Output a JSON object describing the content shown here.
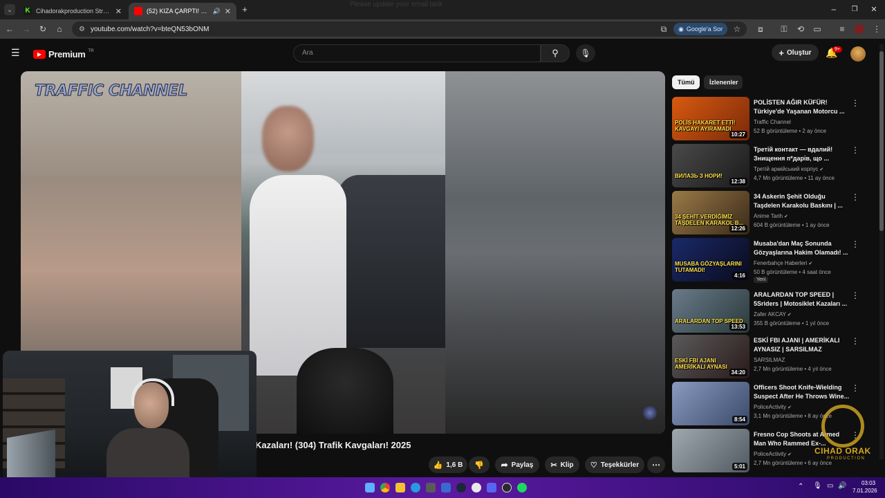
{
  "tabs": [
    {
      "title": "Cihadorakproduction Stream -",
      "favicon": "kick-icon",
      "active": false
    },
    {
      "title": "(52) KIZA ÇARPTI! Türkiye'd",
      "favicon": "youtube-icon",
      "active": true
    }
  ],
  "overlay_text": "Please update your email task",
  "browser": {
    "url": "youtube.com/watch?v=bteQN53bONM",
    "ask_google": "Google'a Sor"
  },
  "youtube": {
    "logo": "Premium",
    "region": "TR",
    "search_placeholder": "Ara",
    "create_label": "Oluştur",
    "notif_badge": "9+"
  },
  "video": {
    "channel_watermark": "TRAFFIC CHANNEL",
    "title_visible": "Kazaları! (304) Trafik Kavgaları! 2025",
    "actions": {
      "likes": "1,6 B",
      "share": "Paylaş",
      "clip": "Klip",
      "thanks": "Teşekkürler"
    }
  },
  "sidebar": {
    "chips": [
      "Tümü",
      "İzlenenler"
    ],
    "recommendations": [
      {
        "title": "POLİSTEN AĞIR KÜFÜR! Türkiye'de Yaşanan Motorcu ...",
        "channel": "Traffic Channel",
        "meta": "52 B görüntüleme • 2 ay önce",
        "duration": "10:27",
        "verified": false,
        "thumb_text": "POLİS HAKARET ETTİ! KAVGAYI AYIRAMADI",
        "thumb_colors": [
          "#d85a10",
          "#7a2a0a"
        ]
      },
      {
        "title": "Третій контакт — вдалий! Знищення п*дарів, що ...",
        "channel": "Третій армійський корпус",
        "meta": "4,7 Mn görüntüleme • 11 ay önce",
        "duration": "12:38",
        "verified": true,
        "thumb_text": "ВИЛАЗЬ З НОРИ!",
        "thumb_colors": [
          "#4a4a4a",
          "#1a1a1a"
        ]
      },
      {
        "title": "34 Askerin Şehit Olduğu Taşdelen Karakolu Baskını | ...",
        "channel": "Anime Tarih",
        "meta": "604 B görüntüleme • 1 ay önce",
        "duration": "12:26",
        "verified": true,
        "thumb_text": "34 ŞEHİT VERDİĞİMİZ TAŞDELEN KARAKOL B...",
        "thumb_colors": [
          "#9a7a48",
          "#3a2a18"
        ]
      },
      {
        "title": "Musaba'dan Maç Sonunda Gözyaşlarına Hakim Olamadı! ...",
        "channel": "Fenerbahçe Haberleri",
        "meta": "50 B görüntüleme • 4 saat önce",
        "duration": "4:16",
        "verified": true,
        "badge": "Yeni",
        "thumb_text": "MUSABA GÖZYAŞLARINI TUTAMADI!",
        "thumb_colors": [
          "#1a2a6a",
          "#0a0a1a"
        ]
      },
      {
        "title": "ARALARDAN TOP SPEED | 5Sriders | Motosiklet Kazaları ...",
        "channel": "Zafer AKCAY",
        "meta": "355 B görüntüleme • 1 yıl önce",
        "duration": "13:53",
        "verified": true,
        "thumb_text": "ARALARDAN TOP SPEED",
        "thumb_colors": [
          "#6a7a8a",
          "#2a3a3a"
        ]
      },
      {
        "title": "ESKİ FBI AJANI | AMERİKALI AYNASIZ | SARSILMAZ",
        "channel": "SARSILMAZ",
        "meta": "2,7 Mn görüntüleme • 4 yıl önce",
        "duration": "34:20",
        "verified": false,
        "thumb_text": "ESKİ FBI AJANI AMERİKALI AYNASI",
        "thumb_colors": [
          "#5a5a5a",
          "#2a1a1a"
        ]
      },
      {
        "title": "Officers Shoot Knife-Wielding Suspect After He Throws Wine...",
        "channel": "PoliceActivity",
        "meta": "3,1 Mn görüntüleme • 8 ay önce",
        "duration": "8:54",
        "verified": true,
        "thumb_text": "",
        "thumb_colors": [
          "#8a9ac0",
          "#3a4a6a"
        ]
      },
      {
        "title": "Fresno Cop Shoots at Armed Man Who Rammed Ex-...",
        "channel": "PoliceActivity",
        "meta": "2,7 Mn görüntüleme • 6 ay önce",
        "duration": "5:01",
        "verified": true,
        "thumb_text": "",
        "thumb_colors": [
          "#a0a8b0",
          "#505860"
        ]
      }
    ]
  },
  "branding": {
    "name": "CIHAD ORAK",
    "sub": "PRODUCTION"
  },
  "clock": {
    "time": "03:03",
    "date": "7.01.2026"
  }
}
